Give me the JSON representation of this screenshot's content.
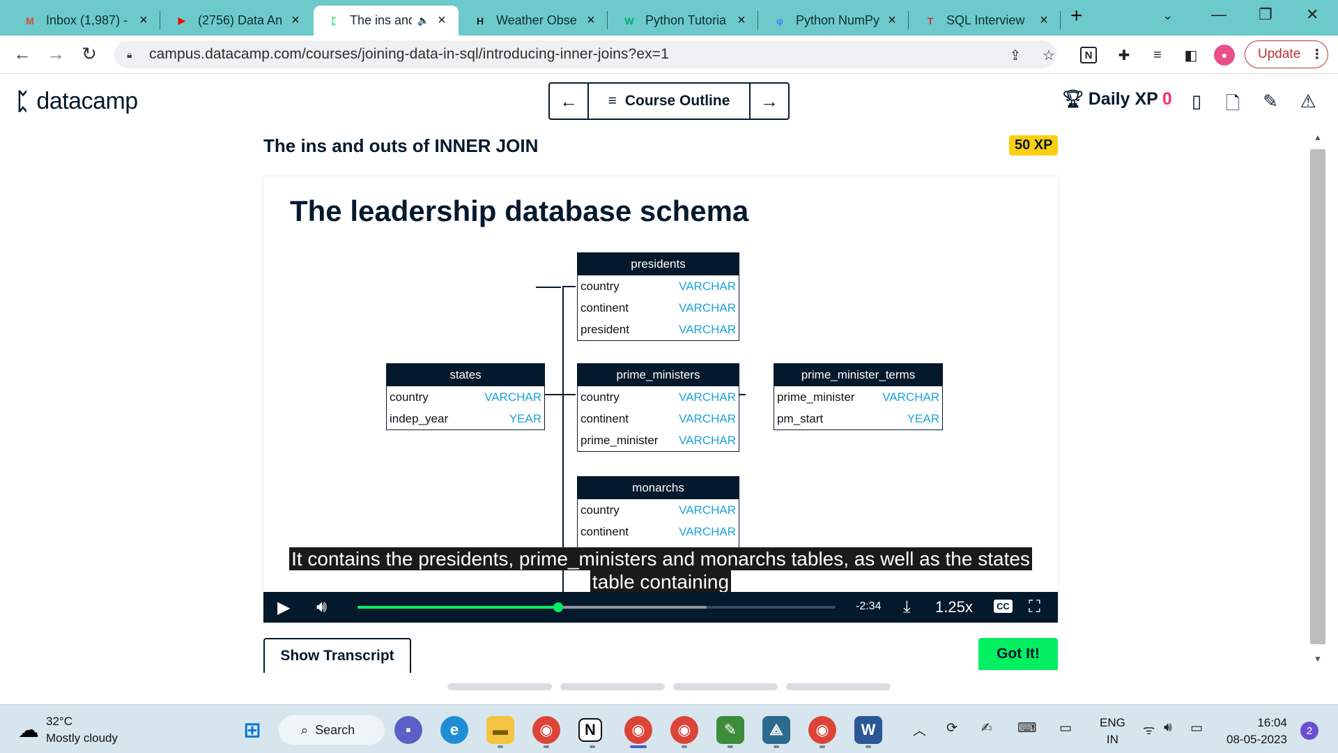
{
  "browser": {
    "tabs": [
      {
        "title": "Inbox (1,987) -",
        "icon": "gmail-icon",
        "fav_glyph": "M",
        "fav_color": "#ea4335"
      },
      {
        "title": "(2756) Data An",
        "icon": "youtube-icon",
        "fav_glyph": "▶",
        "fav_color": "#ff0000"
      },
      {
        "title": "The ins and",
        "icon": "datacamp-icon",
        "fav_glyph": "ᛈ",
        "fav_color": "#03ef62",
        "audio": "🔈"
      },
      {
        "title": "Weather Obse",
        "icon": "hackernoon-icon",
        "fav_glyph": "H",
        "fav_color": "#111111"
      },
      {
        "title": "Python Tutoria",
        "icon": "w3schools-icon",
        "fav_glyph": "W",
        "fav_color": "#04aa6d"
      },
      {
        "title": "Python NumPy",
        "icon": "numpy-icon",
        "fav_glyph": "φ",
        "fav_color": "#4285f4"
      },
      {
        "title": "SQL Interview",
        "icon": "tutorial-icon",
        "fav_glyph": "T",
        "fav_color": "#e22d30"
      }
    ],
    "url": "campus.datacamp.com/courses/joining-data-in-sql/introducing-inner-joins?ex=1",
    "update_label": "Update"
  },
  "header": {
    "logo_text": "datacamp",
    "course_outline": "Course Outline",
    "daily_xp_label": "Daily XP",
    "daily_xp_value": "0"
  },
  "lesson": {
    "title": "The ins and outs of INNER JOIN",
    "xp_badge": "50 XP"
  },
  "slide": {
    "title": "The leadership database schema",
    "tables": {
      "presidents": {
        "name": "presidents",
        "rows": [
          [
            "country",
            "VARCHAR"
          ],
          [
            "continent",
            "VARCHAR"
          ],
          [
            "president",
            "VARCHAR"
          ]
        ]
      },
      "states": {
        "name": "states",
        "rows": [
          [
            "country",
            "VARCHAR"
          ],
          [
            "indep_year",
            "YEAR"
          ]
        ]
      },
      "prime_ministers": {
        "name": "prime_ministers",
        "rows": [
          [
            "country",
            "VARCHAR"
          ],
          [
            "continent",
            "VARCHAR"
          ],
          [
            "prime_minister",
            "VARCHAR"
          ]
        ]
      },
      "pm_terms": {
        "name": "prime_minister_terms",
        "rows": [
          [
            "prime_minister",
            "VARCHAR"
          ],
          [
            "pm_start",
            "YEAR"
          ]
        ]
      },
      "monarchs": {
        "name": "monarchs",
        "rows": [
          [
            "country",
            "VARCHAR"
          ],
          [
            "continent",
            "VARCHAR"
          ]
        ]
      }
    },
    "captions": [
      "It contains the presidents, prime_ministers and monarchs tables, as well as the states",
      "table containing"
    ]
  },
  "player": {
    "time_remaining": "-2:34",
    "speed": "1.25x",
    "progress": 0.42,
    "buffered": 0.73
  },
  "actions": {
    "show_transcript": "Show Transcript",
    "got_it": "Got It!"
  },
  "taskbar": {
    "temperature": "32°C",
    "weather": "Mostly cloudy",
    "search_label": "Search",
    "lang_top": "ENG",
    "lang_bottom": "IN",
    "time": "16:04",
    "date": "08-05-2023",
    "notifications": "2"
  }
}
